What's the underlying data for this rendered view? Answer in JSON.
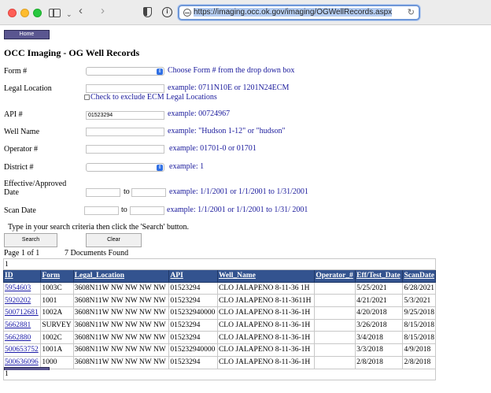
{
  "browser": {
    "url": "https://imaging.occ.ok.gov/imaging/OGWellRecords.aspx"
  },
  "page": {
    "home_label": "Home",
    "title": "OCC Imaging - OG Well Records"
  },
  "form": {
    "form_label": "Form #",
    "form_help": "Choose Form # from the drop down box",
    "legal_label": "Legal Location",
    "legal_help": "example: 0711N10E or 1201N24ECM",
    "ecm_label": "Check to exclude ECM Legal Locations",
    "api_label": "API #",
    "api_value": "01523294",
    "api_help": "example: 00724967",
    "well_label": "Well Name",
    "well_help": "example: \"Hudson 1-12\" or \"hudson\"",
    "operator_label": "Operator #",
    "operator_help": "example: 01701-0 or 01701",
    "district_label": "District #",
    "district_help": "example: 1",
    "effective_label_1": "Effective/Approved",
    "effective_label_2": "Date",
    "effective_to": "to",
    "effective_help": "example: 1/1/2001 or 1/1/2001 to 1/31/2001",
    "scan_label": "Scan Date",
    "scan_to": "to",
    "scan_help": "example: 1/1/2001 or 1/1/2001 to 1/31/ 2001",
    "instructions": "Type in your search criteria then click the 'Search' button.",
    "search_label": "Search",
    "clear_label": "Clear"
  },
  "results": {
    "page_info": "Page 1 of 1",
    "doc_count": "7 Documents Found",
    "pager_top": "1",
    "pager_bottom": "1",
    "columns": [
      "ID",
      "Form",
      "Legal_Location",
      "API",
      "Well_Name",
      "Operator_#",
      "Eff/Test_Date",
      "ScanDate"
    ],
    "rows": [
      {
        "id": "5954603",
        "form": "1003C",
        "legal": "3608N11W NW NW NW NW",
        "api": "01523294",
        "well": "CLO JALAPENO 8-11-36 1H",
        "operator": "",
        "eff": "5/25/2021",
        "scan": "6/28/2021"
      },
      {
        "id": "5920202",
        "form": "1001",
        "legal": "3608N11W NW NW NW NW",
        "api": "01523294",
        "well": "CLO JALAPENO 8-11-3611H",
        "operator": "",
        "eff": "4/21/2021",
        "scan": "5/3/2021"
      },
      {
        "id": "500712681",
        "form": "1002A",
        "legal": "3608N11W NW NW NW NW",
        "api": "015232940000",
        "well": "CLO JALAPENO 8-11-36-1H",
        "operator": "",
        "eff": "4/20/2018",
        "scan": "9/25/2018"
      },
      {
        "id": "5662881",
        "form": "SURVEY",
        "legal": "3608N11W NW NW NW NW",
        "api": "01523294",
        "well": "CLO JALAPENO 8-11-36-1H",
        "operator": "",
        "eff": "3/26/2018",
        "scan": "8/15/2018"
      },
      {
        "id": "5662880",
        "form": "1002C",
        "legal": "3608N11W NW NW NW NW",
        "api": "01523294",
        "well": "CLO JALAPENO 8-11-36-1H",
        "operator": "",
        "eff": "3/4/2018",
        "scan": "8/15/2018"
      },
      {
        "id": "500653752",
        "form": "1001A",
        "legal": "3608N11W NW NW NW NW",
        "api": "015232940000",
        "well": "CLO JALAPENO 8-11-36-1H",
        "operator": "",
        "eff": "3/3/2018",
        "scan": "4/9/2018"
      },
      {
        "id": "500636096",
        "form": "1000",
        "legal": "3608N11W NW NW NW NW",
        "api": "01523294",
        "well": "CLO JALAPENO 8-11-36-1H",
        "operator": "",
        "eff": "2/8/2018",
        "scan": "2/8/2018"
      }
    ]
  }
}
